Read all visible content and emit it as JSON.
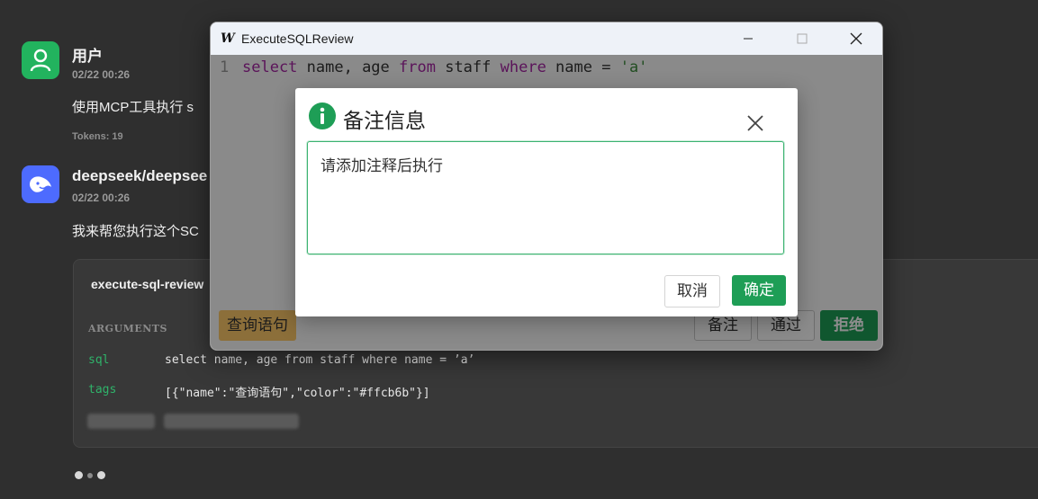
{
  "chat": {
    "user": {
      "name": "用户",
      "time": "02/22 00:26",
      "message": "使用MCP工具执行 s",
      "tokens": "Tokens: 19"
    },
    "bot": {
      "name": "deepseek/deepsee",
      "time": "02/22 00:26",
      "message": "我来帮您执行这个SC"
    }
  },
  "tool_card": {
    "title": "execute-sql-review",
    "args_label": "ARGUMENTS",
    "args": [
      {
        "key": "sql",
        "value": "select name, age from staff where name = ’a’"
      },
      {
        "key": "tags",
        "value": "[{\"name\":\"查询语句\",\"color\":\"#ffcb6b\"}]"
      }
    ]
  },
  "window": {
    "title": "ExecuteSQLReview",
    "icon_letter": "W",
    "line_number": "1",
    "code_tokens": [
      {
        "text": "select",
        "type": "kw"
      },
      {
        "text": " name, age ",
        "type": "plain"
      },
      {
        "text": "from",
        "type": "kw"
      },
      {
        "text": " staff ",
        "type": "plain"
      },
      {
        "text": "where",
        "type": "kw"
      },
      {
        "text": " name = ",
        "type": "plain"
      },
      {
        "text": "'a'",
        "type": "str"
      }
    ],
    "tag_label": "查询语句",
    "tag_color": "#ffcb6b",
    "buttons": {
      "note": "备注",
      "approve": "通过",
      "reject": "拒绝"
    }
  },
  "dialog": {
    "title": "备注信息",
    "textarea_value": "请添加注释后执行",
    "cancel_label": "取消",
    "ok_label": "确定"
  },
  "colors": {
    "accent": "#1e9e56",
    "tag": "#ffcb6b",
    "keyword": "#a626a4",
    "string": "#3f8f3f"
  }
}
